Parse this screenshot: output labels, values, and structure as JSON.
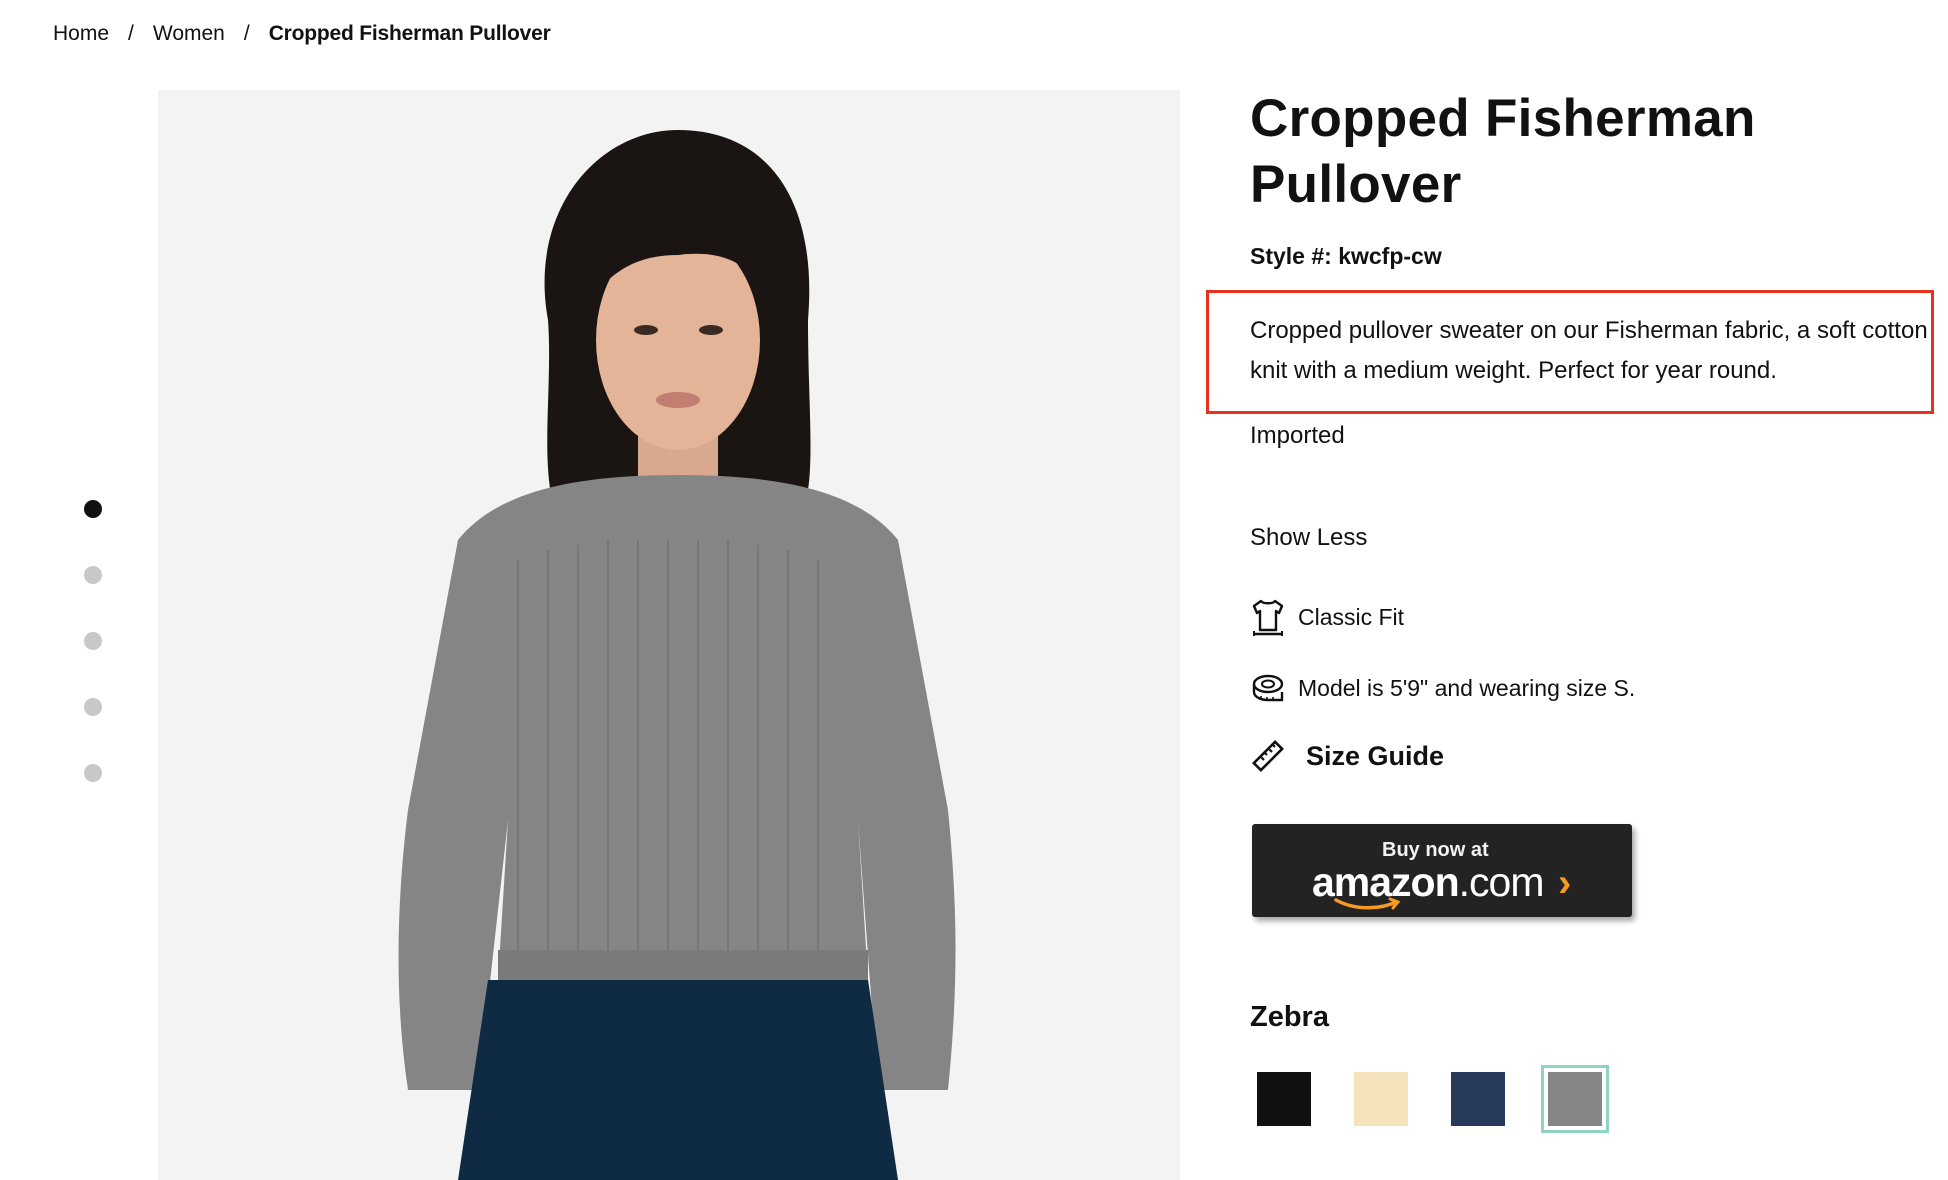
{
  "breadcrumb": {
    "home": "Home",
    "separator": "/",
    "women": "Women",
    "current": "Cropped Fisherman Pullover"
  },
  "gallery": {
    "dot_count": 5,
    "active_index": 0
  },
  "product": {
    "title": "Cropped Fisherman Pullover",
    "style_label": "Style #: kwcfp-cw",
    "description": "Cropped pullover sweater on our Fisherman fabric, a soft cotton knit with a medium weight. Perfect for year round.",
    "origin": "Imported",
    "show_less": "Show Less",
    "fit": "Classic Fit",
    "model_info": "Model is 5'9\" and wearing size S.",
    "size_guide": "Size Guide"
  },
  "amazon_button": {
    "line1": "Buy now at",
    "brand": "amazon",
    "tld": ".com"
  },
  "color": {
    "selected_name": "Zebra",
    "swatches": [
      {
        "name": "black",
        "hex": "#111111"
      },
      {
        "name": "cream",
        "hex": "#f5e4bb"
      },
      {
        "name": "navy",
        "hex": "#283a5a"
      },
      {
        "name": "zebra",
        "hex": "#858585"
      }
    ],
    "selected_index": 3
  },
  "colors": {
    "highlight": "#e8321f",
    "selected_border": "#8fd3c2",
    "amazon_orange": "#f59a23"
  }
}
